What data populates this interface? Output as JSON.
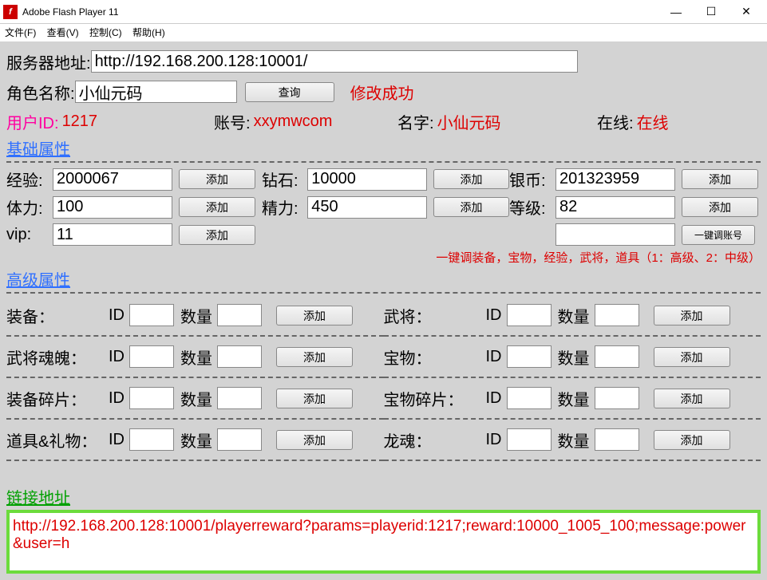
{
  "window": {
    "title": "Adobe Flash Player 11"
  },
  "menu": {
    "file": "文件(F)",
    "view": "查看(V)",
    "control": "控制(C)",
    "help": "帮助(H)"
  },
  "server": {
    "label": "服务器地址:",
    "url": "http://192.168.200.128:10001/"
  },
  "role": {
    "label": "角色名称:",
    "value": "小仙元码",
    "query": "查询",
    "msg": "修改成功"
  },
  "info": {
    "userid_lbl": "用户ID:",
    "userid": "1217",
    "acct_lbl": "账号:",
    "acct": "xxymwcom",
    "name_lbl": "名字:",
    "name": "小仙元码",
    "online_lbl": "在线:",
    "online": "在线"
  },
  "section_base": "基础属性",
  "base": {
    "exp_lbl": "经验:",
    "exp": "2000067",
    "diamond_lbl": "钻石:",
    "diamond": "10000",
    "silver_lbl": "银币:",
    "silver": "201323959",
    "stamina_lbl": "体力:",
    "stamina": "100",
    "energy_lbl": "精力:",
    "energy": "450",
    "level_lbl": "等级:",
    "level": "82",
    "vip_lbl": "vip:",
    "vip": "11",
    "onekey_input": "",
    "onekey_btn": "一键调账号",
    "add": "添加",
    "note": "一键调装备，宝物，经验，武将，道具（1：高级、2：中级）"
  },
  "section_adv": "高级属性",
  "adv": {
    "id": "ID",
    "qty": "数量",
    "add": "添加",
    "equip": "装备：",
    "general": "武将：",
    "soul": "武将魂魄：",
    "treasure": "宝物：",
    "equip_frag": "装备碎片：",
    "treasure_frag": "宝物碎片：",
    "item": "道具&礼物：",
    "dragon": "龙魂："
  },
  "section_link": "链接地址",
  "link": "http://192.168.200.128:10001/playerreward?params=playerid:1217;reward:10000_1005_100;message:power&user=h"
}
